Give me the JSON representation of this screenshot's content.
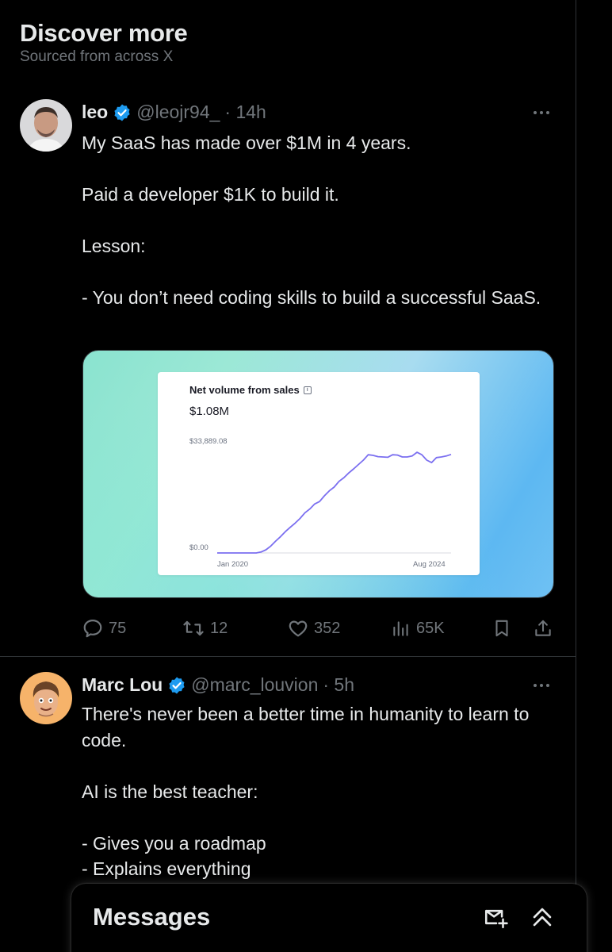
{
  "section": {
    "title": "Discover more",
    "subtitle": "Sourced from across X"
  },
  "tweets": [
    {
      "name": "leo",
      "handle": "@leojr94_",
      "time": "· 14h",
      "text": "My SaaS has made over $1M in 4 years.\n\nPaid a developer $1K to build it.\n\nLesson:\n\n- You don’t need coding skills to build a successful SaaS.",
      "avatar_icon": "profile-photo-man",
      "stats": {
        "replies": "75",
        "reposts": "12",
        "likes": "352",
        "views": "65K"
      },
      "media": {
        "title": "Net volume from sales",
        "value": "$1.08M",
        "y_max_label": "$33,889.08",
        "y_min_label": "$0.00",
        "x_start_label": "Jan 2020",
        "x_end_label": "Aug 2024"
      }
    },
    {
      "name": "Marc Lou",
      "handle": "@marc_louvion",
      "time": "· 5h",
      "text": "There's never been a better time in humanity to learn to code.\n\nAI is the best teacher:\n\n- Gives you a roadmap\n- Explains everything",
      "avatar_icon": "cartoon-avatar"
    }
  ],
  "chart_data": {
    "type": "line",
    "title": "Net volume from sales",
    "x_labels": [
      "Jan 2020",
      "Aug 2024"
    ],
    "ylim": [
      0,
      33889.08
    ],
    "grid": false,
    "series": [
      {
        "values": [
          0,
          0,
          0,
          0,
          0,
          0,
          0,
          0,
          0,
          300,
          1000,
          2200,
          3800,
          5200,
          6800,
          8200,
          9500,
          11000,
          12800,
          14000,
          15600,
          16400,
          18200,
          19800,
          21000,
          22800,
          24000,
          25500,
          26800,
          28200,
          29600,
          31300,
          31100,
          30700,
          30600,
          30500,
          31300,
          31200,
          30600,
          30600,
          30900,
          32100,
          31300,
          29600,
          28800,
          30400,
          30600,
          30900,
          31400
        ]
      }
    ]
  },
  "colors": {
    "accent": "#1d9bf0",
    "chart_line": "#7b6ff0",
    "muted": "#71767b",
    "text": "#e7e9ea",
    "background": "#000000"
  },
  "dock": {
    "title": "Messages",
    "new_message_icon": "new-message-icon",
    "expand_icon": "double-chevron-up-icon"
  }
}
